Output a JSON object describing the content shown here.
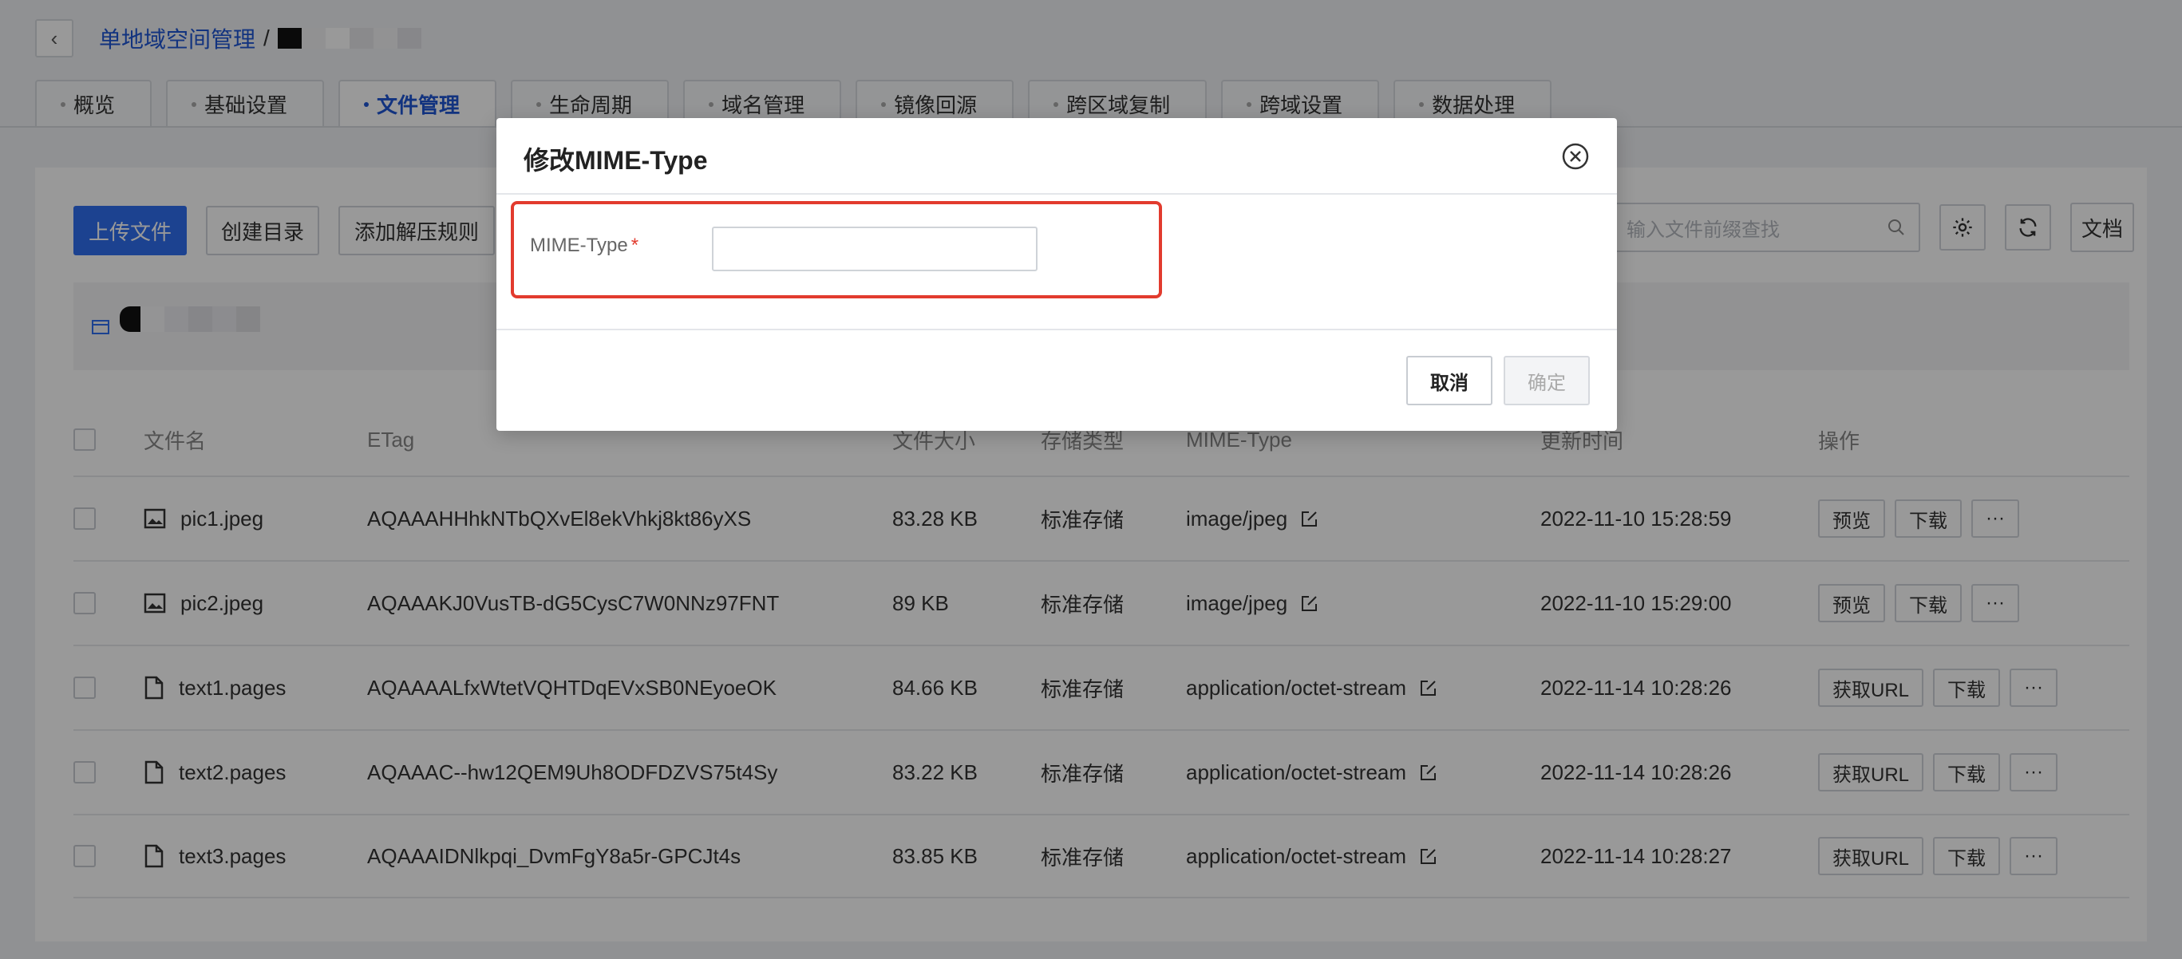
{
  "header": {
    "back_icon": "chevron-left-icon",
    "breadcrumb_parent": "单地域空间管理",
    "breadcrumb_sep": "/"
  },
  "tabs": [
    {
      "label": "概览",
      "active": false
    },
    {
      "label": "基础设置",
      "active": false
    },
    {
      "label": "文件管理",
      "active": true
    },
    {
      "label": "生命周期",
      "active": false
    },
    {
      "label": "域名管理",
      "active": false
    },
    {
      "label": "镜像回源",
      "active": false
    },
    {
      "label": "跨区域复制",
      "active": false
    },
    {
      "label": "跨域设置",
      "active": false
    },
    {
      "label": "数据处理",
      "active": false
    }
  ],
  "toolbar": {
    "upload_label": "上传文件",
    "mkdir_label": "创建目录",
    "unzip_rule_label": "添加解压规则",
    "search_placeholder": "输入文件前缀查找",
    "docs_label": "文档"
  },
  "table": {
    "headers": {
      "name": "文件名",
      "etag": "ETag",
      "size": "文件大小",
      "storage": "存储类型",
      "mime": "MIME-Type",
      "time": "更新时间",
      "ops": "操作"
    },
    "rows": [
      {
        "icon": "image-icon",
        "name": "pic1.jpeg",
        "etag": "AQAAAHHhkNTbQXvEl8ekVhkj8kt86yXS",
        "size": "83.28 KB",
        "storage": "标准存储",
        "mime": "image/jpeg",
        "time": "2022-11-10 15:28:59",
        "op1": "预览",
        "op2": "下载",
        "op3": "···"
      },
      {
        "icon": "image-icon",
        "name": "pic2.jpeg",
        "etag": "AQAAAKJ0VusTB-dG5CysC7W0NNz97FNT",
        "size": "89 KB",
        "storage": "标准存储",
        "mime": "image/jpeg",
        "time": "2022-11-10 15:29:00",
        "op1": "预览",
        "op2": "下载",
        "op3": "···"
      },
      {
        "icon": "file-icon",
        "name": "text1.pages",
        "etag": "AQAAAALfxWtetVQHTDqEVxSB0NEyoeOK",
        "size": "84.66 KB",
        "storage": "标准存储",
        "mime": "application/octet-stream",
        "time": "2022-11-14 10:28:26",
        "op1": "获取URL",
        "op2": "下载",
        "op3": "···"
      },
      {
        "icon": "file-icon",
        "name": "text2.pages",
        "etag": "AQAAAC--hw12QEM9Uh8ODFDZVS75t4Sy",
        "size": "83.22 KB",
        "storage": "标准存储",
        "mime": "application/octet-stream",
        "time": "2022-11-14 10:28:26",
        "op1": "获取URL",
        "op2": "下载",
        "op3": "···"
      },
      {
        "icon": "file-icon",
        "name": "text3.pages",
        "etag": "AQAAAIDNlkpqi_DvmFgY8a5r-GPCJt4s",
        "size": "83.85 KB",
        "storage": "标准存储",
        "mime": "application/octet-stream",
        "time": "2022-11-14 10:28:27",
        "op1": "获取URL",
        "op2": "下载",
        "op3": "···"
      }
    ]
  },
  "modal": {
    "title": "修改MIME-Type",
    "field_label": "MIME-Type",
    "required_mark": "*",
    "field_value": "",
    "cancel_label": "取消",
    "ok_label": "确定"
  },
  "colors": {
    "accent": "#1f55d4",
    "primary_button": "#2f6ff0",
    "highlight_border": "#e23b2e"
  }
}
